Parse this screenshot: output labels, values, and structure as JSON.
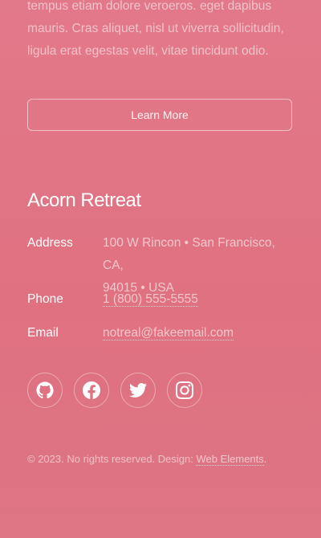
{
  "intro": {
    "text": "tempus etiam dolore veroeros. eget dapibus mauris. Cras aliquet, nisl ut viverra sollicitudin, ligula erat egestas velit, vitae tincidunt odio."
  },
  "learn_more": {
    "label": "Learn More"
  },
  "contact": {
    "title": "Acorn Retreat",
    "address_label": "Address",
    "address_line1": "100 W Rincon • San Francisco, CA,",
    "address_line2": "94015 • USA",
    "phone_label": "Phone",
    "phone_value": "1 (800) 555-5555",
    "email_label": "Email",
    "email_value": "notreal@fakeemail.com"
  },
  "social": {
    "icons": [
      "github-icon",
      "facebook-icon",
      "twitter-icon",
      "instagram-icon"
    ]
  },
  "footer": {
    "copyright_prefix": "© 2023. No rights reserved. Design: ",
    "design_link": "Web Elements",
    "copyright_suffix": "."
  },
  "colors": {
    "background": "#e17483",
    "text": "#ffffff"
  }
}
